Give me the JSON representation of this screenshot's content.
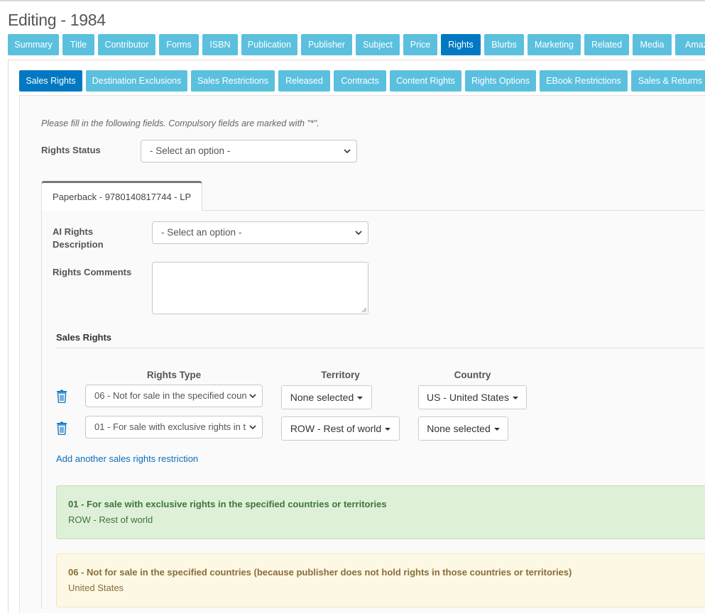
{
  "page": {
    "title": "Editing - 1984"
  },
  "main_tabs": [
    {
      "label": "Summary",
      "active": false
    },
    {
      "label": "Title",
      "active": false
    },
    {
      "label": "Contributor",
      "active": false
    },
    {
      "label": "Forms",
      "active": false
    },
    {
      "label": "ISBN",
      "active": false
    },
    {
      "label": "Publication",
      "active": false
    },
    {
      "label": "Publisher",
      "active": false
    },
    {
      "label": "Subject",
      "active": false
    },
    {
      "label": "Price",
      "active": false
    },
    {
      "label": "Rights",
      "active": true
    },
    {
      "label": "Blurbs",
      "active": false
    },
    {
      "label": "Marketing",
      "active": false
    },
    {
      "label": "Related",
      "active": false
    },
    {
      "label": "Media",
      "active": false
    },
    {
      "label": "Amaz",
      "active": false
    }
  ],
  "sub_tabs": [
    {
      "label": "Sales Rights",
      "active": true
    },
    {
      "label": "Destination Exclusions",
      "active": false
    },
    {
      "label": "Sales Restrictions",
      "active": false
    },
    {
      "label": "Released",
      "active": false
    },
    {
      "label": "Contracts",
      "active": false
    },
    {
      "label": "Content Rights",
      "active": false
    },
    {
      "label": "Rights Options",
      "active": false
    },
    {
      "label": "EBook Restrictions",
      "active": false
    },
    {
      "label": "Sales & Returns",
      "active": false
    }
  ],
  "form": {
    "hint": "Please fill in the following fields. Compulsory fields are marked with \"*\".",
    "rights_status_label": "Rights Status",
    "rights_status_value": "- Select an option -"
  },
  "product_tab": {
    "label": "Paperback - 9780140817744 - LP"
  },
  "product_form": {
    "ai_rights_label_line1": "AI Rights",
    "ai_rights_label_line2": "Description",
    "ai_rights_value": "- Select an option -",
    "rights_comments_label": "Rights Comments",
    "rights_comments_value": ""
  },
  "sales_rights": {
    "title": "Sales Rights",
    "col_rights_type": "Rights Type",
    "col_territory": "Territory",
    "col_country": "Country",
    "rows": [
      {
        "rights_type": "06 - Not for sale in the specified coun",
        "territory": "None selected",
        "country": "US - United States"
      },
      {
        "rights_type": "01 - For sale with exclusive rights in t",
        "territory": "ROW - Rest of world",
        "country": "None selected"
      }
    ],
    "add_link": "Add another sales rights restriction"
  },
  "summaries": [
    {
      "status": "success",
      "title": "01 - For sale with exclusive rights in the specified countries or territories",
      "text": "ROW - Rest of world",
      "color": "#3c763d"
    },
    {
      "status": "warning",
      "title": "06 - Not for sale in the specified countries (because publisher does not hold rights in those countries or territories)",
      "text": "United States",
      "color": "#8a6d3b"
    }
  ],
  "colors": {
    "tab": "#5bc0de",
    "tab_active": "#0079c2",
    "link": "#0a6ebd"
  }
}
